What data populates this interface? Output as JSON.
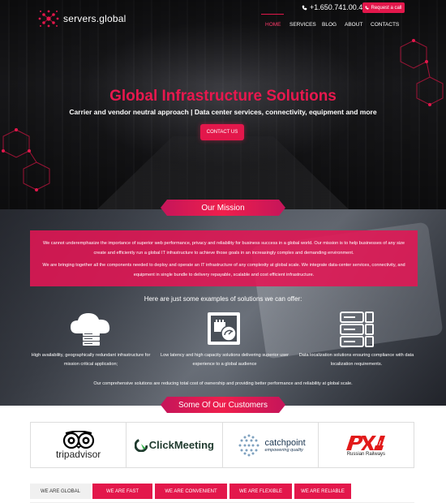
{
  "header": {
    "logo_text": "servers.global",
    "phone": "+1.650.741.00.42",
    "request_label": "Request a call",
    "nav": [
      "HOME",
      "SERVICES",
      "BLOG",
      "ABOUT",
      "CONTACTS"
    ],
    "active_nav": "HOME"
  },
  "hero": {
    "title": "Global Infrastructure Solutions",
    "subtitle": "Carrier and vendor neutral approach | Data center services, connectivity, equipment and more",
    "cta_label": "CONTACT US"
  },
  "mission": {
    "heading": "Our Mission",
    "paragraph1": "We cannot underemphasize the importance of superior web performance, privacy and reliability for business success in a global world. Our mission is to help businesses of any size create and efficiently run a global IT infrastructure to achieve those goals in an increasingly complex and demanding environment.",
    "paragraph2": "We are bringing together all the components needed to deploy and operate an IT infrastructure of any complexity at global scale. We integrate data-center services, connectivity, and equipment in single bundle to delivery repayable, scalable and cost efficient infrastructure.",
    "examples_heading": "Here are just some examples of solutions we can offer:",
    "features": [
      {
        "icon": "cloud-server-icon",
        "text": "High availability, geographically redundant infrastructure for mission critical application;"
      },
      {
        "icon": "speed-network-icon",
        "text": "Low latency and high capacity solutions delivering superior user experience to a global audience"
      },
      {
        "icon": "server-rack-icon",
        "text": "Data localization solutions ensuring compliance with data localization requirements."
      }
    ],
    "summary": "Our comprehensive solutions are reducing total cost of ownership and providing better performance and reliability at global scale."
  },
  "customers": {
    "heading": "Some Of Our Customers",
    "logos": [
      {
        "name": "tripadvisor",
        "text": "tripadvisor"
      },
      {
        "name": "clickmeeting",
        "text": "ClickMeeting"
      },
      {
        "name": "catchpoint",
        "text": "catchpoint",
        "tagline": "empowering quality"
      },
      {
        "name": "russian-railways",
        "text": "Russian Railways"
      }
    ]
  },
  "tabs": [
    "WE ARE GLOBAL",
    "WE ARE FAST",
    "WE ARE CONVENIENT",
    "WE ARE FLEXIBLE",
    "WE ARE RELIABLE"
  ],
  "colors": {
    "accent": "#e3174b",
    "hero_title": "#e8184e"
  }
}
